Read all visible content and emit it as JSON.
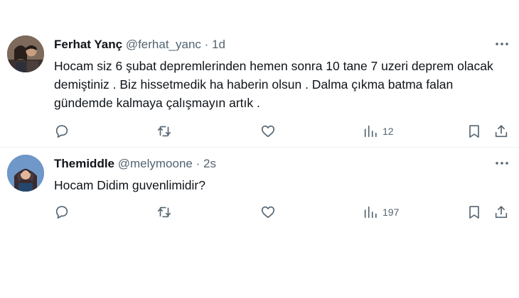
{
  "tweets": [
    {
      "name": "Ferhat Yanç",
      "handle": "@ferhat_yanc",
      "separator": "·",
      "time": "1d",
      "text": "Hocam siz 6 şubat depremlerinden hemen sonra 10 tane 7 uzeri deprem olacak demiştiniz . Biz hissetmedik ha haberin olsun . Dalma çıkma batma falan gündemde kalmaya çalışmayın artık .",
      "views": "12",
      "avatar_icon": "profile-photo-couple"
    },
    {
      "name": "Themiddle",
      "handle": "@melymoone",
      "separator": "·",
      "time": "2s",
      "text": "Hocam Didim guvenlimidir?",
      "views": "197",
      "avatar_icon": "profile-photo-woman-headscarf"
    }
  ],
  "icons": {
    "more": "more-dots-icon",
    "reply": "reply-icon",
    "retweet": "retweet-icon",
    "like": "heart-icon",
    "views": "views-chart-icon",
    "bookmark": "bookmark-icon",
    "share": "share-icon"
  },
  "colors": {
    "text": "#0f1419",
    "secondary": "#536471",
    "divider": "#eff3f4"
  }
}
